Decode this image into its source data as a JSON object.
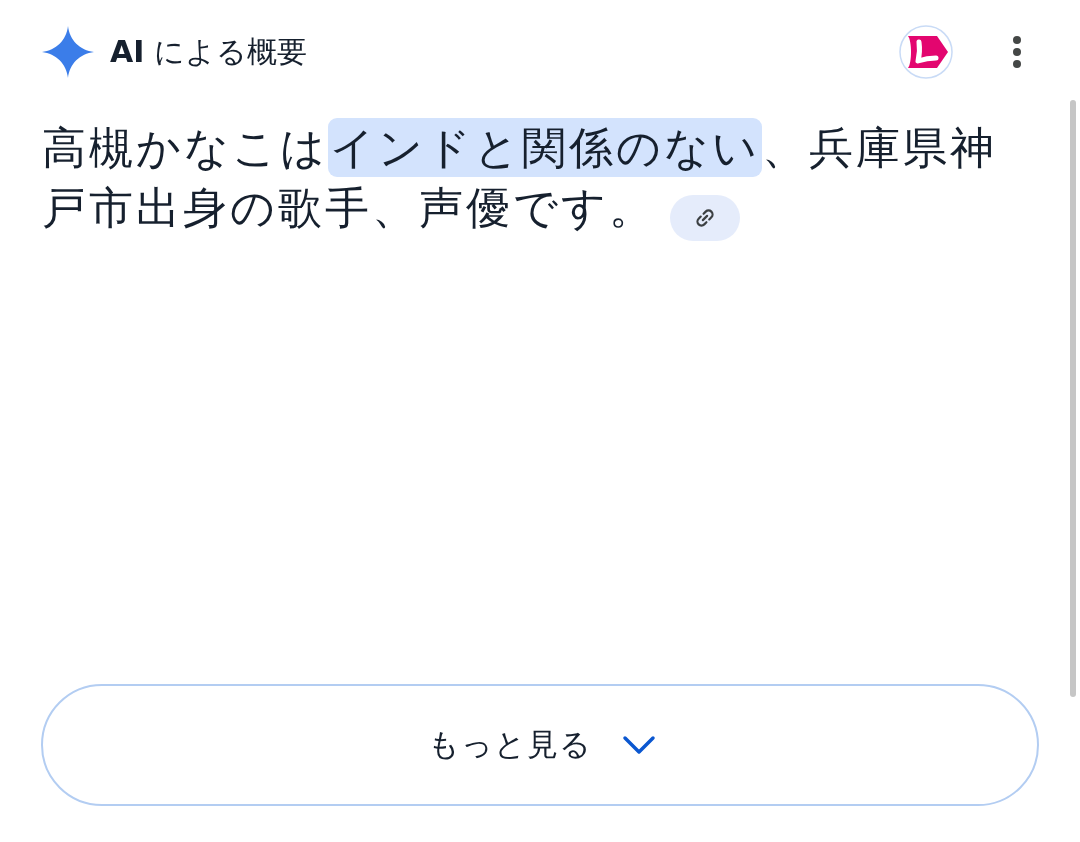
{
  "header": {
    "title": "**AI** による概要"
  },
  "answer": {
    "segments": [
      {
        "text": "高槻かなこは",
        "highlighted": false
      },
      {
        "text": "インドと関係のない",
        "highlighted": true
      },
      {
        "text": "、兵庫県神戸市出身の歌手、声優です。",
        "highlighted": false
      }
    ]
  },
  "more_button": {
    "label": "もっと見る"
  }
}
